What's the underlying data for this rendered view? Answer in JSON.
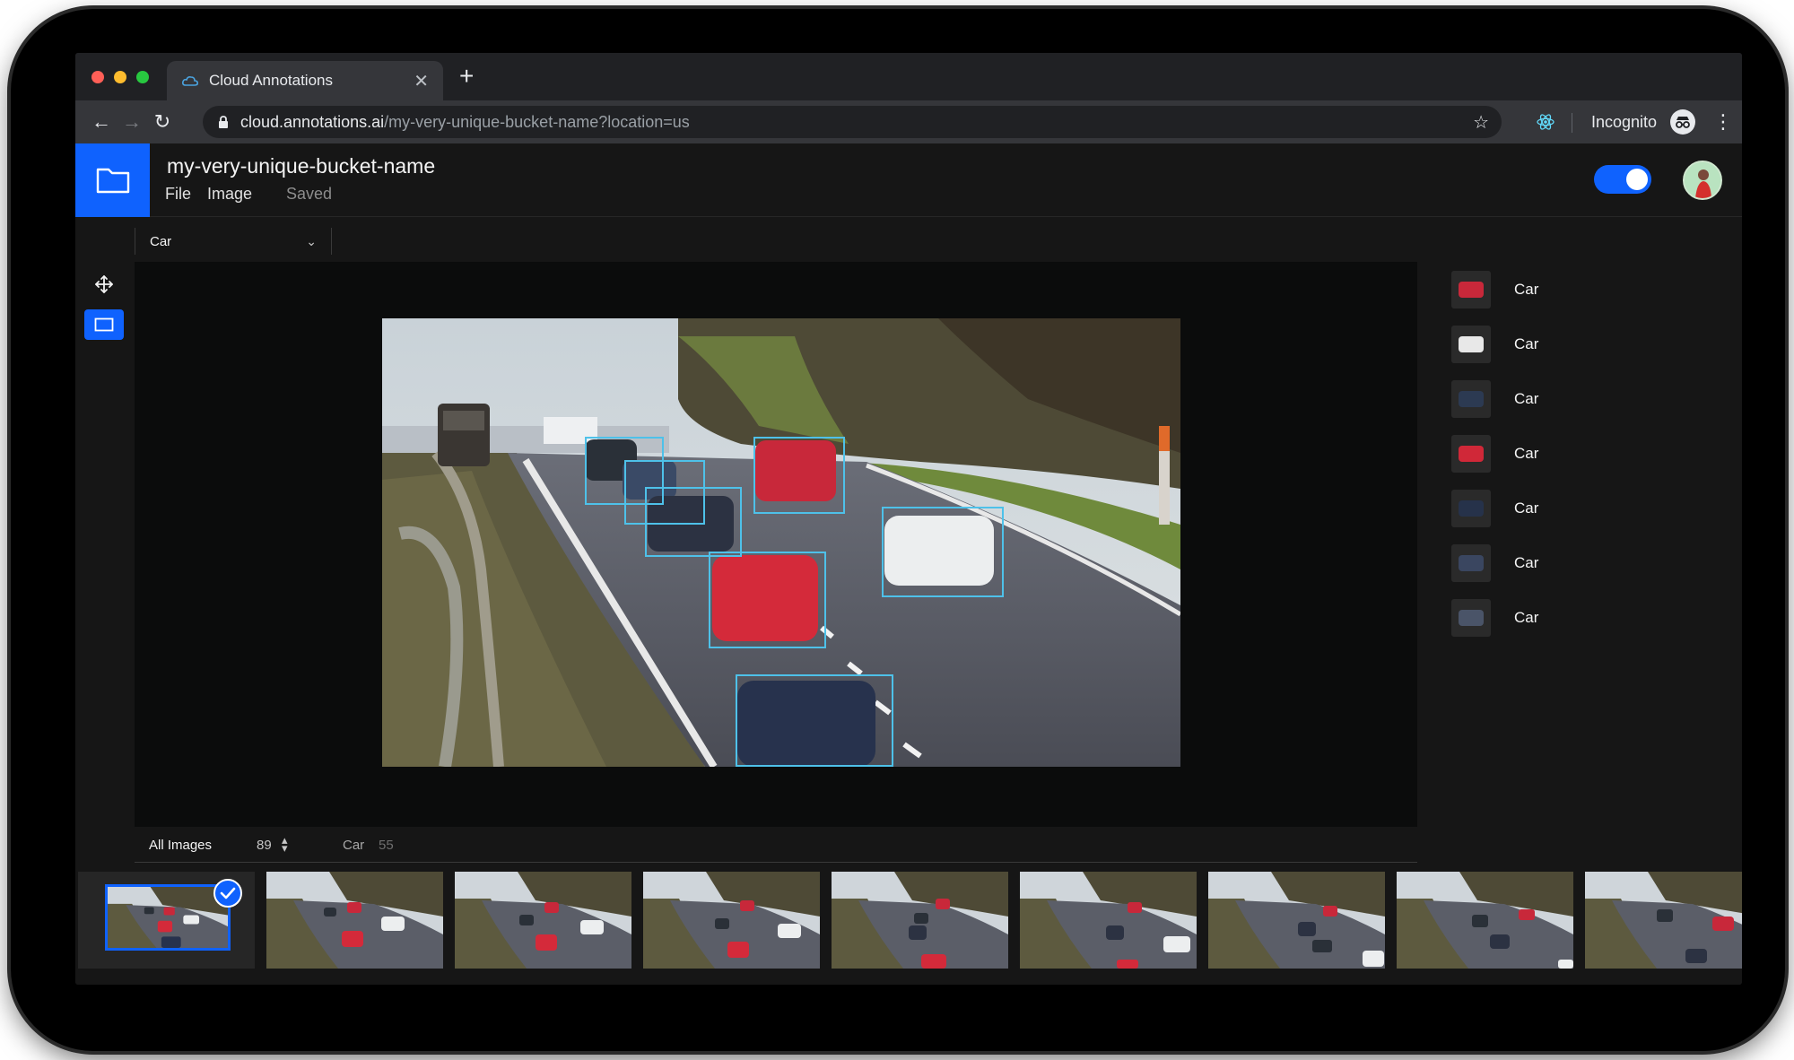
{
  "browser": {
    "tab_title": "Cloud Annotations",
    "url_host": "cloud.annotations.ai",
    "url_path": "/my-very-unique-bucket-name?location=us",
    "incognito_label": "Incognito"
  },
  "app": {
    "bucket_name": "my-very-unique-bucket-name",
    "menu": {
      "file": "File",
      "image": "Image"
    },
    "save_status": "Saved",
    "toggle_on": true,
    "accent_color": "#0f62fe",
    "box_color": "#4ec1e9"
  },
  "label_select": {
    "value": "Car"
  },
  "tools": [
    {
      "name": "move",
      "icon": "move-arrows-icon",
      "active": false
    },
    {
      "name": "box",
      "icon": "bounding-box-icon",
      "active": true
    }
  ],
  "annotations": [
    {
      "label": "Car",
      "thumb_color": "#c8283a"
    },
    {
      "label": "Car",
      "thumb_color": "#e8e8e8"
    },
    {
      "label": "Car",
      "thumb_color": "#2c3a52"
    },
    {
      "label": "Car",
      "thumb_color": "#d02838"
    },
    {
      "label": "Car",
      "thumb_color": "#26324a"
    },
    {
      "label": "Car",
      "thumb_color": "#3a4660"
    },
    {
      "label": "Car",
      "thumb_color": "#4a5468"
    }
  ],
  "filter": {
    "all_images_label": "All Images",
    "all_images_count": "89",
    "label_name": "Car",
    "label_count": "55"
  },
  "thumbnails": {
    "count": 9,
    "selected_index": 0
  }
}
